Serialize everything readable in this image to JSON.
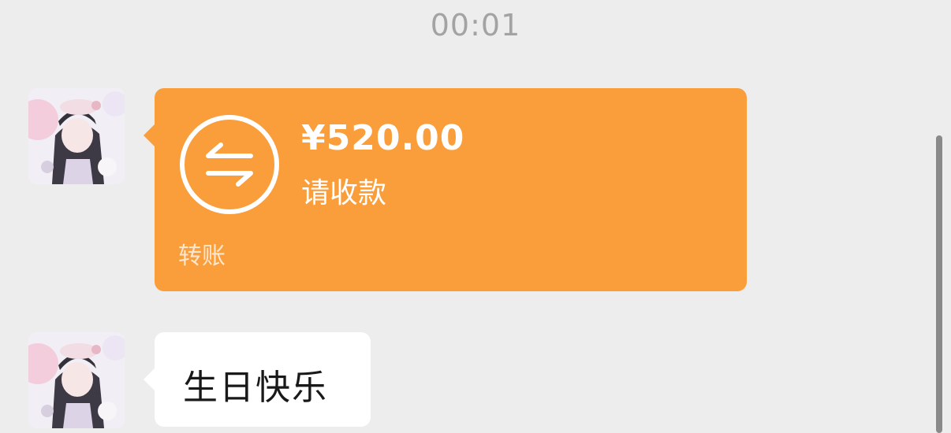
{
  "chat": {
    "timestamp": "00:01",
    "messages": [
      {
        "type": "transfer",
        "sender": "contact",
        "amount": "¥520.00",
        "status": "请收款",
        "footer": "转账",
        "icon": "transfer-arrows-icon",
        "card_color": "#fa9d3b"
      },
      {
        "type": "text",
        "sender": "contact",
        "text": "生日快乐",
        "bubble_color": "#ffffff"
      }
    ]
  },
  "colors": {
    "background": "#ededed",
    "timestamp": "#a3a3a3",
    "transfer_accent": "#fa9d3b"
  }
}
